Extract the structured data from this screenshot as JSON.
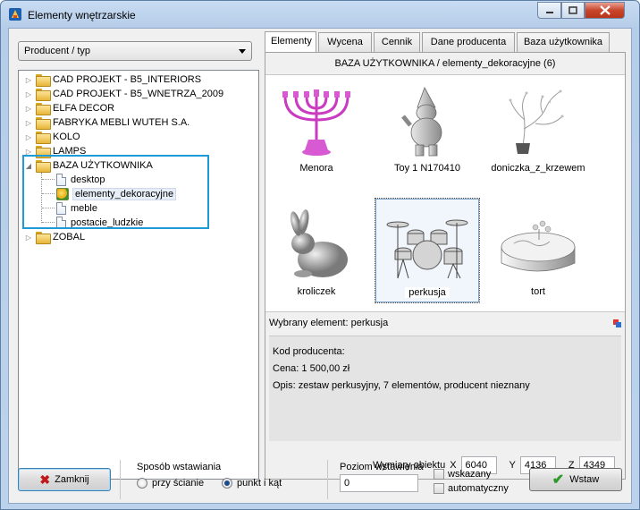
{
  "window": {
    "title": "Elementy wnętrzarskie"
  },
  "left": {
    "combo_value": "Producent / typ",
    "tree": [
      {
        "label": "CAD PROJEKT - B5_INTERIORS",
        "type": "folder",
        "expander": "▷"
      },
      {
        "label": "CAD PROJEKT - B5_WNETRZA_2009",
        "type": "folder",
        "expander": "▷"
      },
      {
        "label": "ELFA DECOR",
        "type": "folder",
        "expander": "▷"
      },
      {
        "label": "FABRYKA MEBLI WUTEH S.A.",
        "type": "folder",
        "expander": "▷"
      },
      {
        "label": "KOLO",
        "type": "folder",
        "expander": "▷"
      },
      {
        "label": "LAMPS",
        "type": "folder",
        "expander": "▷"
      },
      {
        "label": "BAZA UŻYTKOWNIKA",
        "type": "folder",
        "expander": "◢"
      },
      {
        "label": "desktop",
        "type": "doc"
      },
      {
        "label": "elementy_dekoracyjne",
        "type": "deco"
      },
      {
        "label": "meble",
        "type": "doc"
      },
      {
        "label": "postacie_ludzkie",
        "type": "doc"
      },
      {
        "label": "ZOBAL",
        "type": "folder",
        "expander": "▷"
      }
    ]
  },
  "tabs": [
    "Elementy",
    "Wycena",
    "Cennik",
    "Dane producenta",
    "Baza użytkownika"
  ],
  "path_header": "BAZA UŻYTKOWNIKA / elementy_dekoracyjne (6)",
  "gallery": [
    {
      "label": "Menora"
    },
    {
      "label": "Toy 1 N170410"
    },
    {
      "label": "doniczka_z_krzewem"
    },
    {
      "label": "kroliczek"
    },
    {
      "label": "perkusja"
    },
    {
      "label": "tort"
    }
  ],
  "info": {
    "title": "Wybrany element: perkusja",
    "kod": "Kod producenta:",
    "cena": "Cena: 1 500,00 zł",
    "opis": "Opis: zestaw perkusyjny, 7 elementów, producent nieznany"
  },
  "dims": {
    "label": "Wymiary obiektu",
    "x_label": "X",
    "x_value": "6040",
    "y_label": "Y",
    "y_value": "4136",
    "z_label": "Z",
    "z_value": "4349"
  },
  "bottom": {
    "close_label": "Zamknij",
    "mode_group": "Sposób wstawiania",
    "mode_wall": "przy ścianie",
    "mode_point": "punkt i kąt",
    "level_group": "Poziom wstawienia",
    "level_value": "0",
    "chk_indicated": "wskazany",
    "chk_auto": "automatyczny",
    "insert_label": "Wstaw"
  },
  "colors": {
    "highlight": "#1e9bd7",
    "close_x": "#c01818",
    "check": "#2a9a2a"
  }
}
